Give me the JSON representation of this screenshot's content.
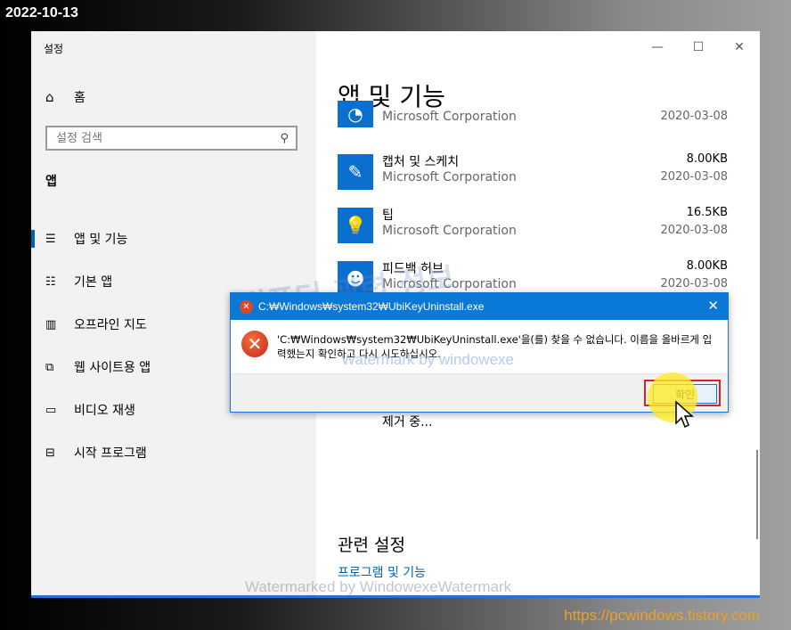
{
  "date_label": "2022-10-13",
  "url_label": "https://pcwindows.tistory.com",
  "window": {
    "title": "설정",
    "controls": {
      "minimize": "—",
      "maximize": "☐",
      "close": "✕"
    }
  },
  "sidebar": {
    "home": "홈",
    "search_placeholder": "설정 검색",
    "section": "앱",
    "items": [
      {
        "label": "앱 및 기능",
        "icon": "apps-features-icon"
      },
      {
        "label": "기본 앱",
        "icon": "default-apps-icon"
      },
      {
        "label": "오프라인 지도",
        "icon": "offline-maps-icon"
      },
      {
        "label": "웹 사이트용 앱",
        "icon": "apps-for-websites-icon"
      },
      {
        "label": "비디오 재생",
        "icon": "video-playback-icon"
      },
      {
        "label": "시작 프로그램",
        "icon": "startup-icon"
      }
    ]
  },
  "main": {
    "title": "앱 및 기능",
    "apps": [
      {
        "name": "",
        "publisher": "Microsoft Corporation",
        "size": "",
        "date": "2020-03-08",
        "icon": "app-icon"
      },
      {
        "name": "캡처 및 스케치",
        "publisher": "Microsoft Corporation",
        "size": "8.00KB",
        "date": "2020-03-08",
        "icon": "snip-sketch-icon"
      },
      {
        "name": "팁",
        "publisher": "Microsoft Corporation",
        "size": "16.5KB",
        "date": "2020-03-08",
        "icon": "tips-icon"
      },
      {
        "name": "피드백 허브",
        "publisher": "Microsoft Corporation",
        "size": "8.00KB",
        "date": "2020-03-08",
        "icon": "feedback-hub-icon"
      }
    ],
    "removing": "제거 중...",
    "related_title": "관련 설정",
    "related_link": "프로그램 및 기능"
  },
  "dialog": {
    "title": "C:₩Windows₩system32₩UbiKeyUninstall.exe",
    "message": "'C:₩Windows₩system32₩UbiKeyUninstall.exe'을(를) 찾을 수 없습니다. 이름을 올바르게 입력했는지 확인하고 다시 시도하십시오.",
    "ok_label": "확인"
  },
  "watermarks": {
    "bottom": "Watermarked by WindowexeWatermark",
    "dialog": "Watermark by windowexe",
    "korean": "컴퓨터 관련 정보"
  }
}
